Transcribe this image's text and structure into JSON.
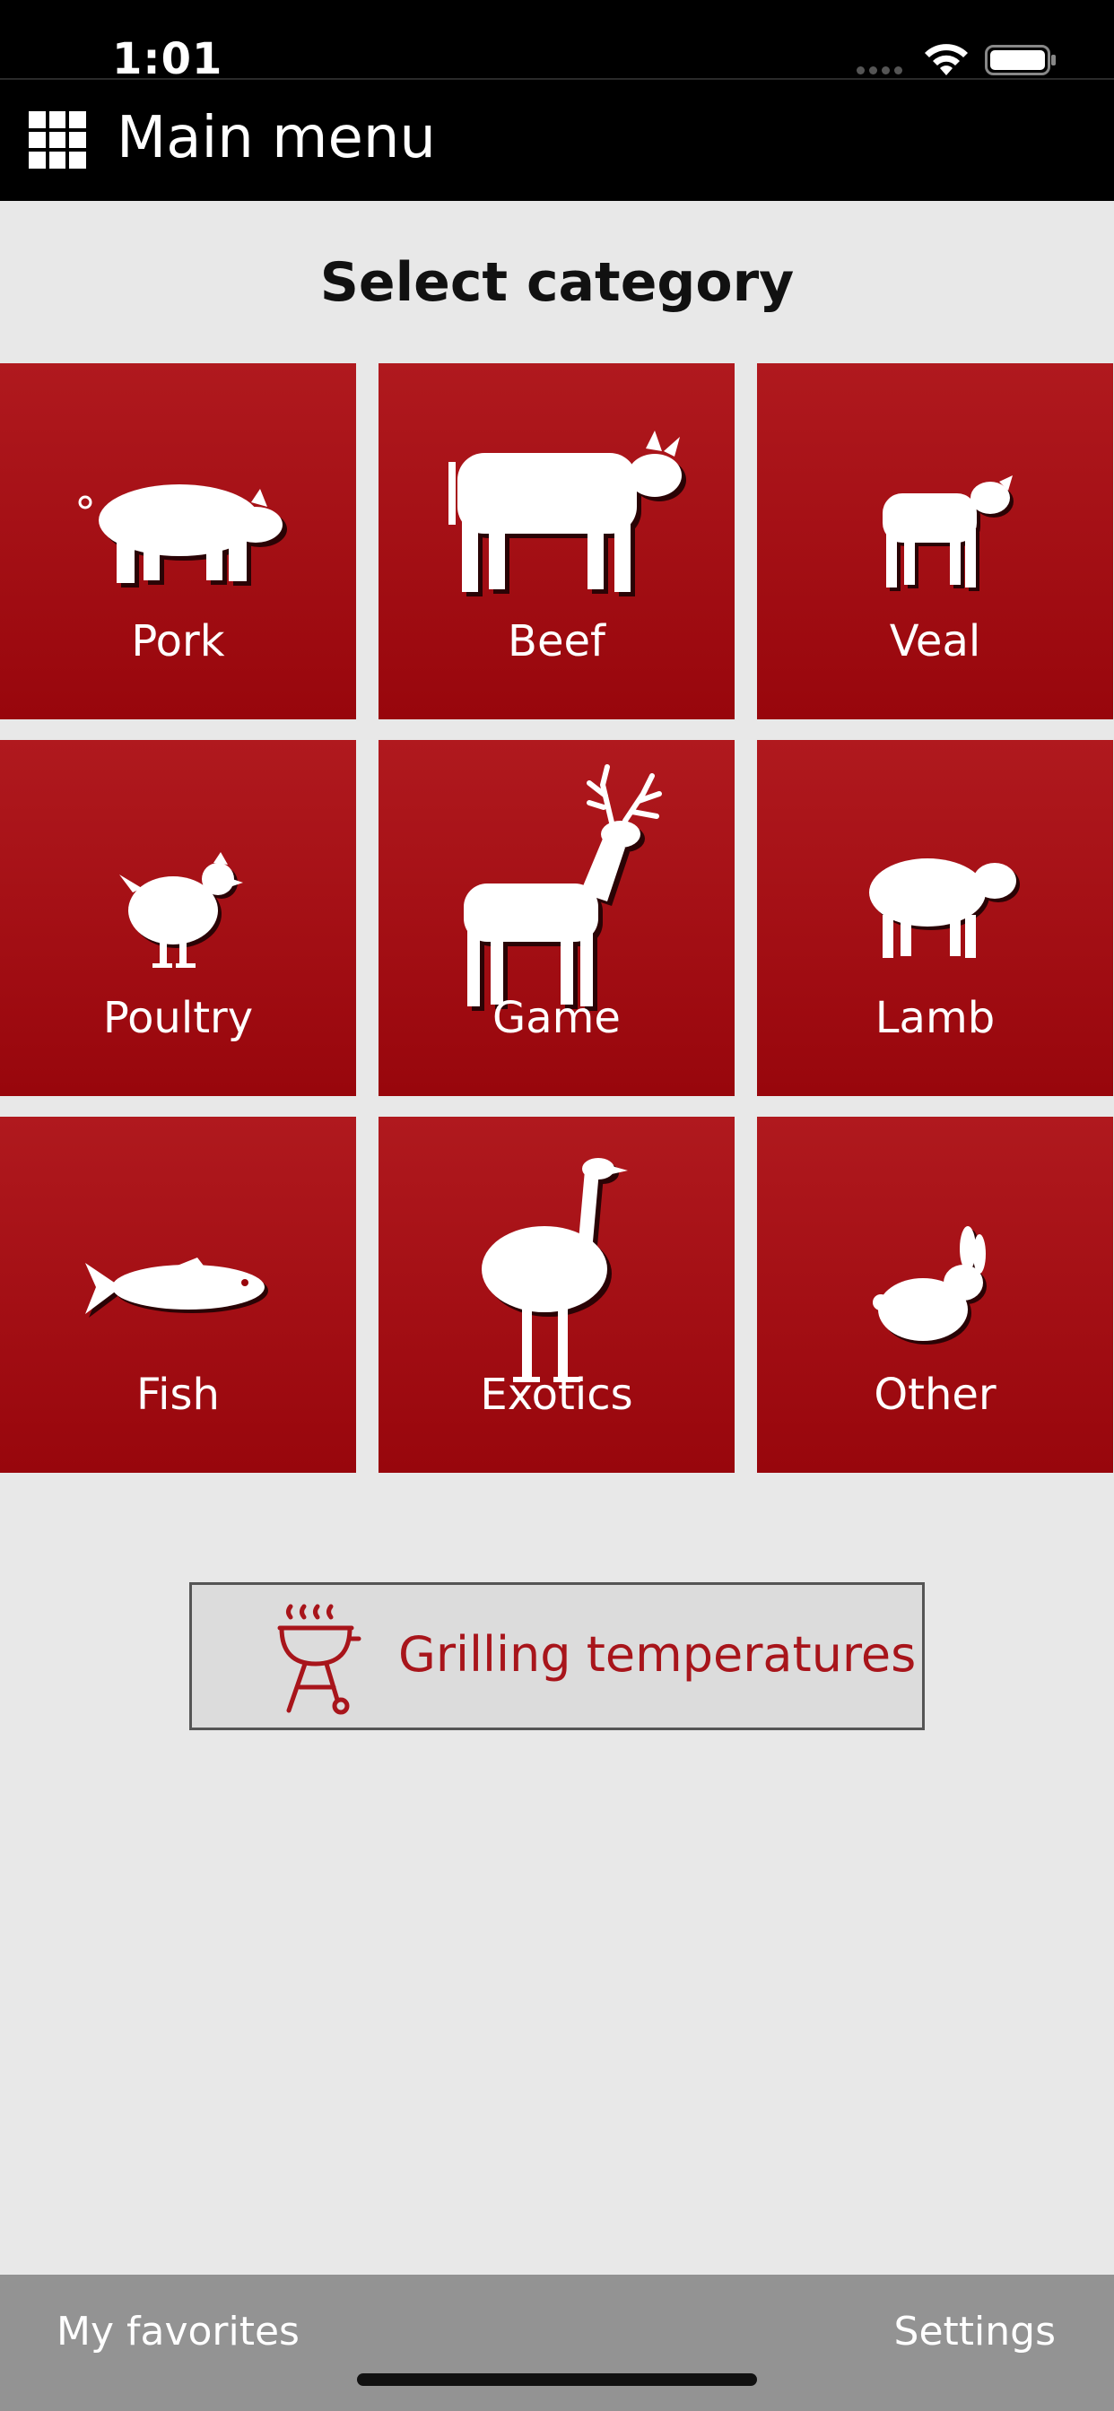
{
  "status_bar": {
    "time": "1:01"
  },
  "header": {
    "title": "Main menu"
  },
  "page": {
    "title": "Select category"
  },
  "categories": [
    {
      "label": "Pork",
      "icon": "pig-icon"
    },
    {
      "label": "Beef",
      "icon": "cow-icon"
    },
    {
      "label": "Veal",
      "icon": "calf-icon"
    },
    {
      "label": "Poultry",
      "icon": "chicken-icon"
    },
    {
      "label": "Game",
      "icon": "deer-icon"
    },
    {
      "label": "Lamb",
      "icon": "sheep-icon"
    },
    {
      "label": "Fish",
      "icon": "fish-icon"
    },
    {
      "label": "Exotics",
      "icon": "ostrich-icon"
    },
    {
      "label": "Other",
      "icon": "rabbit-icon"
    }
  ],
  "grill_button": {
    "label": "Grilling temperatures",
    "icon": "grill-icon"
  },
  "bottom_bar": {
    "favorites_label": "My favorites",
    "settings_label": "Settings"
  },
  "colors": {
    "tile_red": "#a80f15",
    "accent_text": "#a8151b",
    "background": "#e8e8e8"
  }
}
